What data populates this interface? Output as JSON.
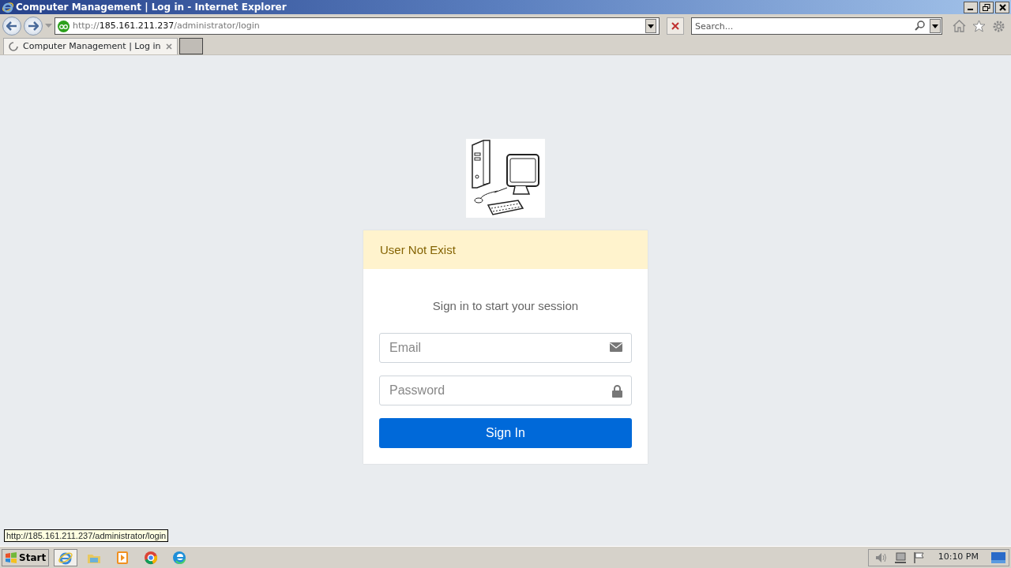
{
  "window": {
    "title": "Computer Management | Log in - Internet Explorer"
  },
  "address_bar": {
    "scheme": "http://",
    "host": "185.161.211.237",
    "path": "/administrator/login"
  },
  "search": {
    "placeholder": "Search..."
  },
  "tabs": [
    {
      "label": "Computer Management | Log in",
      "selected": true,
      "loading": true
    }
  ],
  "page": {
    "alert": "User Not Exist",
    "message": "Sign in to start your session",
    "fields": [
      {
        "placeholder": "Email",
        "kind": "email"
      },
      {
        "placeholder": "Password",
        "kind": "password"
      }
    ],
    "submit": "Sign In"
  },
  "status_bar": {
    "link": "http://185.161.211.237/administrator/login"
  },
  "taskbar": {
    "start": "Start",
    "apps": [
      {
        "kind": "ie",
        "selected": true
      },
      {
        "kind": "folder",
        "selected": false
      },
      {
        "kind": "media",
        "selected": false
      },
      {
        "kind": "chrome",
        "selected": false
      },
      {
        "kind": "edge",
        "selected": false
      }
    ],
    "clock": "10:10 PM"
  }
}
